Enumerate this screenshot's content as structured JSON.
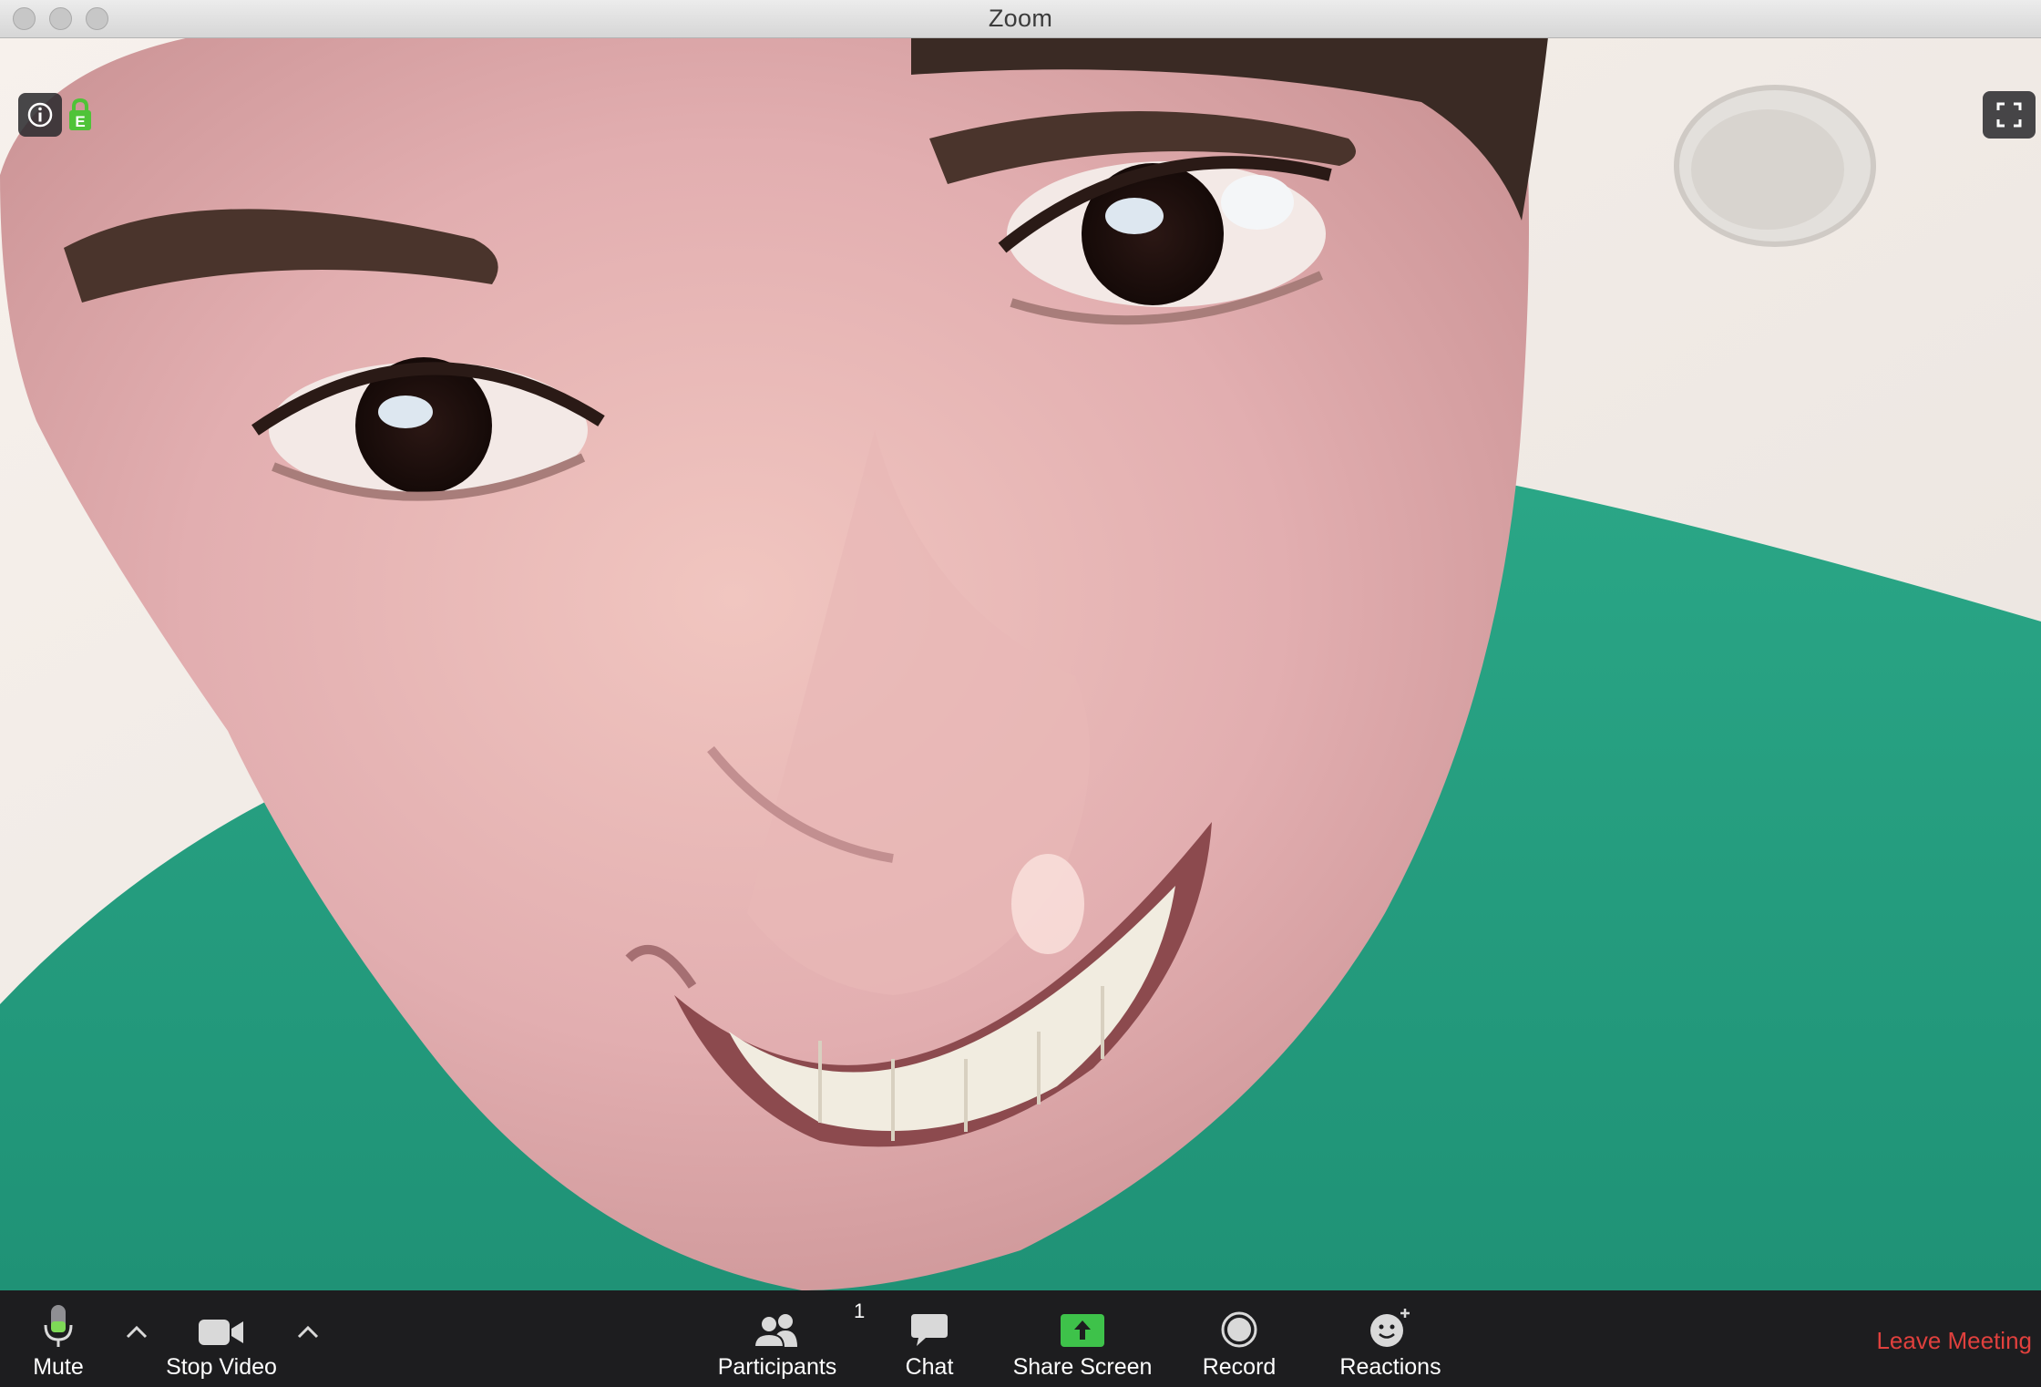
{
  "window": {
    "title": "Zoom"
  },
  "video": {
    "encryption_badge": "E"
  },
  "toolbar": {
    "mute_label": "Mute",
    "stop_video_label": "Stop Video",
    "participants_label": "Participants",
    "participants_count": "1",
    "chat_label": "Chat",
    "share_screen_label": "Share Screen",
    "record_label": "Record",
    "reactions_label": "Reactions",
    "leave_label": "Leave Meeting"
  },
  "colors": {
    "share_green": "#3ec24a",
    "leave_red": "#e0403d",
    "mic_green": "#7ed957",
    "lock_green": "#4fc338"
  },
  "icons": {
    "mute": "microphone-icon",
    "video": "video-camera-icon",
    "participants": "people-icon",
    "chat": "chat-bubble-icon",
    "share": "share-screen-arrow-icon",
    "record": "record-circle-icon",
    "reactions": "smiley-plus-icon",
    "info": "info-icon",
    "lock": "lock-icon",
    "fullscreen": "fullscreen-icon"
  }
}
